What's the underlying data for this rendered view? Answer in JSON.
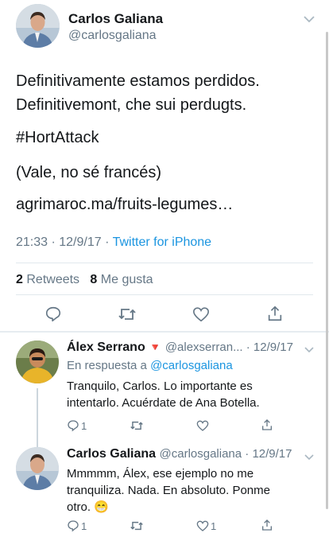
{
  "main_tweet": {
    "author_name": "Carlos Galiana",
    "author_handle": "@carlosgaliana",
    "line1": "Definitivamente estamos perdidos.",
    "line2": "Definitivemont, che sui perdugts.",
    "hashtag": "#HortAttack",
    "line3": "(Vale, no sé francés)",
    "link": "agrimaroc.ma/fruits-legumes…",
    "timestamp": "21:33 · 12/9/17 ·",
    "source": "Twitter for iPhone",
    "retweets_count": "2",
    "retweets_label": "Retweets",
    "likes_count": "8",
    "likes_label": "Me gusta"
  },
  "replies": [
    {
      "author_name": "Álex Serrano",
      "badge": "🔻",
      "handle_date": "@alexserran... · 12/9/17",
      "reply_to_label": "En respuesta a",
      "reply_to_handle": "@carlosgaliana",
      "text": "Tranquilo, Carlos. Lo importante es intentarlo. Acuérdate de Ana Botella.",
      "reply_count": "1",
      "like_count": ""
    },
    {
      "author_name": "Carlos Galiana",
      "handle_date": "@carlosgaliana · 12/9/17",
      "text": "Mmmmm, Álex, ese ejemplo no me tranquiliza. Nada. En absoluto. Ponme otro. 😁",
      "reply_count": "1",
      "like_count": "1"
    }
  ],
  "colors": {
    "link": "#1b95e0",
    "muted": "#657786",
    "badge": "#e0245e"
  }
}
